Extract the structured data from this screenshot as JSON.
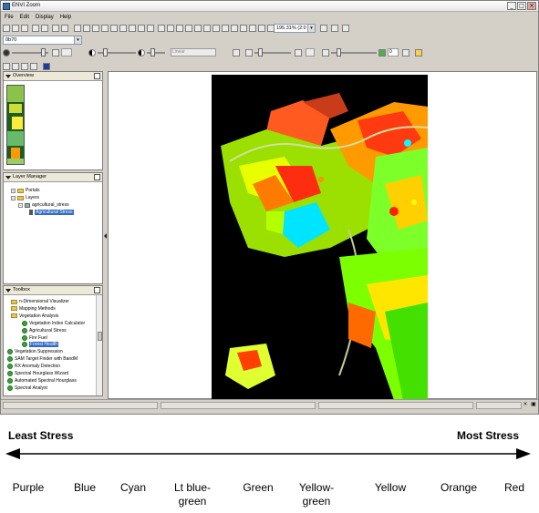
{
  "window": {
    "title": "ENVI Zoom"
  },
  "menu": [
    "File",
    "Edit",
    "Display",
    "Help"
  ],
  "toolbar": {
    "zoom_value": "195.31% (2:0",
    "band_value": "0b70",
    "disabled_field": "Linear",
    "numeric_field": "0"
  },
  "panels": {
    "overview": {
      "title": "Overview"
    },
    "layer_manager": {
      "title": "Layer Manager",
      "items": [
        "Portals",
        "Layers",
        "agricultural_stress",
        "Agricultural Stress"
      ]
    },
    "toolbox": {
      "title": "Toolbox",
      "items": [
        "n-Dimensional Visualizer",
        "Mapping Methods",
        "Vegetation Analysis",
        "Vegetation Index Calculator",
        "Agricultural Stress",
        "Fire Fuel",
        "Forest Health",
        "Vegetation Suppression",
        "SAM Target Finder with BandM",
        "RX Anomaly Detection",
        "Spectral Hourglass Wizard",
        "Automated Spectral Hourglass",
        "Spectral Analyst"
      ]
    }
  },
  "legend": {
    "least": "Least Stress",
    "most": "Most Stress",
    "labels": [
      "Purple",
      "Blue",
      "Cyan",
      "Lt blue-\ngreen",
      "Green",
      "Yellow-\ngreen",
      "Yellow",
      "Orange",
      "Red"
    ]
  },
  "colors": {
    "black": "#000000",
    "green": "#00ff00",
    "yellow": "#ffff00",
    "lime": "#aaff00",
    "orange": "#ff8800",
    "red": "#ff2200",
    "cyan": "#00ffff",
    "purple": "#aa00aa",
    "blue": "#0000ff"
  }
}
